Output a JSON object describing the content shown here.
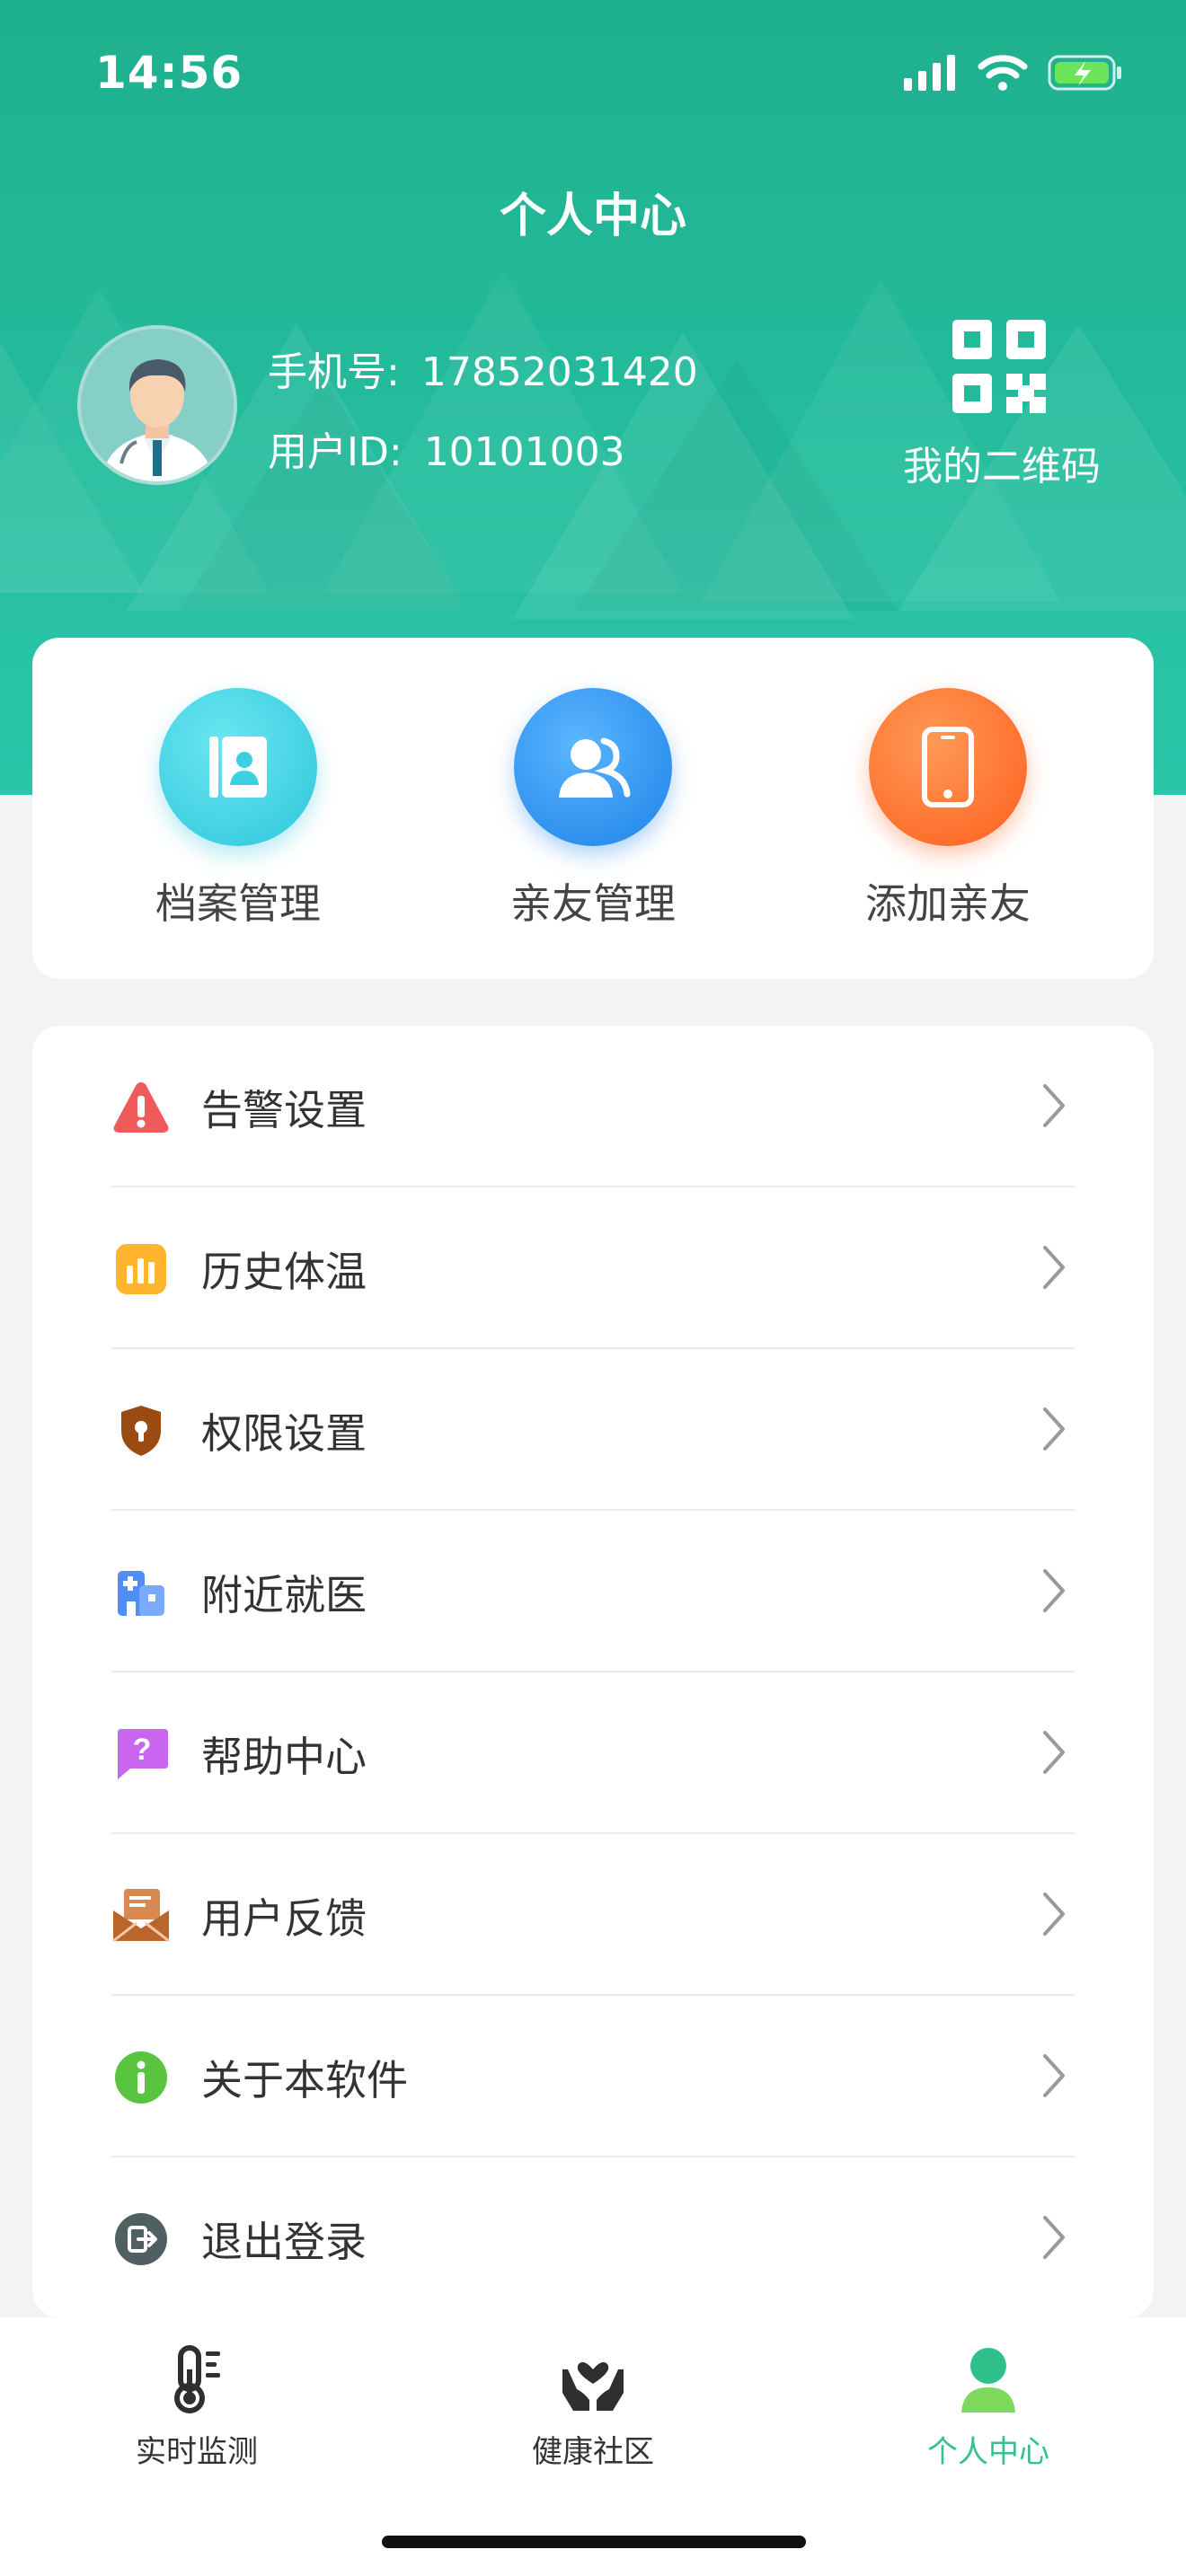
{
  "status_bar": {
    "time": "14:56"
  },
  "header": {
    "title": "个人中心",
    "phone_label": "手机号:",
    "phone_value": "17852031420",
    "userid_label": "用户ID:",
    "userid_value": "10101003",
    "qr_label": "我的二维码"
  },
  "quick_actions": [
    {
      "label": "档案管理",
      "icon": "profile-card-icon",
      "color": "#3fd3e3"
    },
    {
      "label": "亲友管理",
      "icon": "contacts-icon",
      "color": "#2f8ff0"
    },
    {
      "label": "添加亲友",
      "icon": "phone-icon",
      "color": "#ff6b2b"
    }
  ],
  "menu": [
    {
      "label": "告警设置",
      "icon": "warning-icon"
    },
    {
      "label": "历史体温",
      "icon": "chart-icon"
    },
    {
      "label": "权限设置",
      "icon": "shield-lock-icon"
    },
    {
      "label": "附近就医",
      "icon": "hospital-icon"
    },
    {
      "label": "帮助中心",
      "icon": "help-icon"
    },
    {
      "label": "用户反馈",
      "icon": "mail-icon"
    },
    {
      "label": "关于本软件",
      "icon": "info-icon"
    },
    {
      "label": "退出登录",
      "icon": "logout-icon"
    }
  ],
  "tabbar": [
    {
      "label": "实时监测",
      "icon": "thermometer-icon",
      "active": false
    },
    {
      "label": "健康社区",
      "icon": "heart-hands-icon",
      "active": false
    },
    {
      "label": "个人中心",
      "icon": "person-icon",
      "active": true
    }
  ],
  "colors": {
    "primary": "#22b999",
    "active_tab": "#34c18d"
  }
}
